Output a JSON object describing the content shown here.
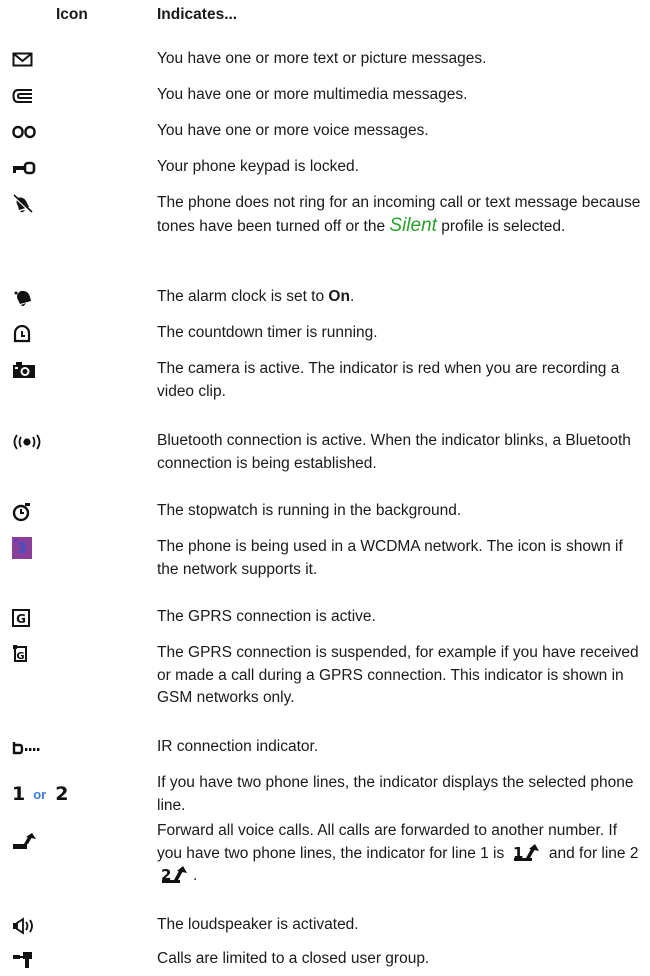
{
  "header": {
    "icon_col": "Icon",
    "indicates_col": "Indicates..."
  },
  "rows": [
    {
      "icon": "envelope-icon",
      "text": "You have one or more text or picture messages."
    },
    {
      "icon": "multimedia-message-icon",
      "text": "You have one or more multimedia messages."
    },
    {
      "icon": "voicemail-icon",
      "text": "You have one or more voice messages."
    },
    {
      "icon": "keypad-lock-icon",
      "text": "Your phone keypad is locked."
    },
    {
      "icon": "silent-bell-icon",
      "text_a": "The phone does not ring for an incoming call or text message because tones have been turned off or the ",
      "emph": "Silent",
      "text_b": " profile is selected."
    },
    {
      "icon": "alarm-bell-icon",
      "text_a": "The alarm clock is set to ",
      "bold": "On",
      "text_b": "."
    },
    {
      "icon": "countdown-timer-icon",
      "text": "The countdown timer is running."
    },
    {
      "icon": "camera-icon",
      "text": "The camera is active. The indicator is red when you are recording a video clip."
    },
    {
      "icon": "bluetooth-icon",
      "text": "Bluetooth connection is active. When the indicator blinks, a Bluetooth connection is being established."
    },
    {
      "icon": "stopwatch-icon",
      "text": "The stopwatch is running in the background."
    },
    {
      "icon": "wcdma-network-icon",
      "text": "The phone is being used in a WCDMA network. The icon is shown if the network supports it."
    },
    {
      "icon": "gprs-active-icon",
      "text": "The GPRS connection is active."
    },
    {
      "icon": "gprs-suspended-icon",
      "text": "The GPRS connection is suspended, for example if you have received or made a call during a GPRS connection. This indicator is shown in GSM networks only."
    },
    {
      "icon": "ir-connection-icon",
      "text": "IR connection indicator."
    },
    {
      "icon": "phone-line-icons",
      "line1": "1",
      "or": "or",
      "line2": "2",
      "text": "If you have two phone lines, the indicator displays the selected phone line."
    },
    {
      "icon": "call-forward-icon",
      "text_a": "Forward all voice calls. All calls are forwarded to another number. If you have two phone lines, the indicator for line 1 is ",
      "text_b": " and for line 2 ",
      "text_c": "."
    },
    {
      "icon": "loudspeaker-icon",
      "text": "The loudspeaker is activated."
    },
    {
      "icon": "closed-user-group-icon",
      "text": "Calls are limited to a closed user group."
    }
  ]
}
